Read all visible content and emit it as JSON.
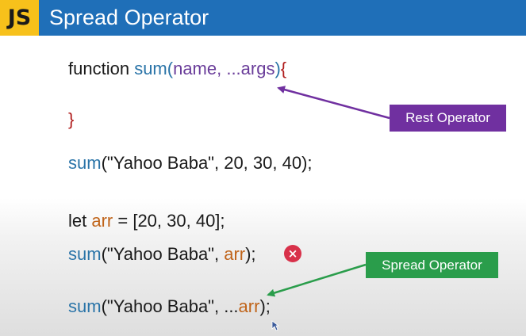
{
  "header": {
    "badge": "JS",
    "title": "Spread Operator"
  },
  "code": {
    "line1": {
      "keyword": "function",
      "fn": "sum",
      "open": "(",
      "params": "name, ...args",
      "close": ")",
      "brace": "{"
    },
    "line2": {
      "brace": "}"
    },
    "line3": {
      "fn": "sum",
      "args": "(\"Yahoo Baba\", 20, 30, 40);"
    },
    "line4": {
      "keyword": "let",
      "var": "arr",
      "rest": " = [20, 30, 40];"
    },
    "line5": {
      "fn": "sum",
      "args_start": "(\"Yahoo Baba\", ",
      "var": "arr",
      "args_end": ");"
    },
    "line6": {
      "fn": "sum",
      "args_start": "(\"Yahoo Baba\", ...",
      "var": "arr",
      "args_end": ");"
    }
  },
  "annotations": {
    "rest_operator": "Rest Operator",
    "spread_operator": "Spread Operator",
    "error_symbol": "×"
  },
  "colors": {
    "header_bg": "#1f6fb8",
    "badge_bg": "#f7c11b",
    "function_name": "#2a74a8",
    "parameters": "#6a3d9a",
    "brace": "#b01c1c",
    "variable": "#c0641a",
    "rest_tag": "#7030a0",
    "spread_tag": "#2a9d4b",
    "error_icon": "#d8314a"
  },
  "icons": {
    "error": "error-x-icon",
    "cursor": "mouse-pointer-icon"
  }
}
